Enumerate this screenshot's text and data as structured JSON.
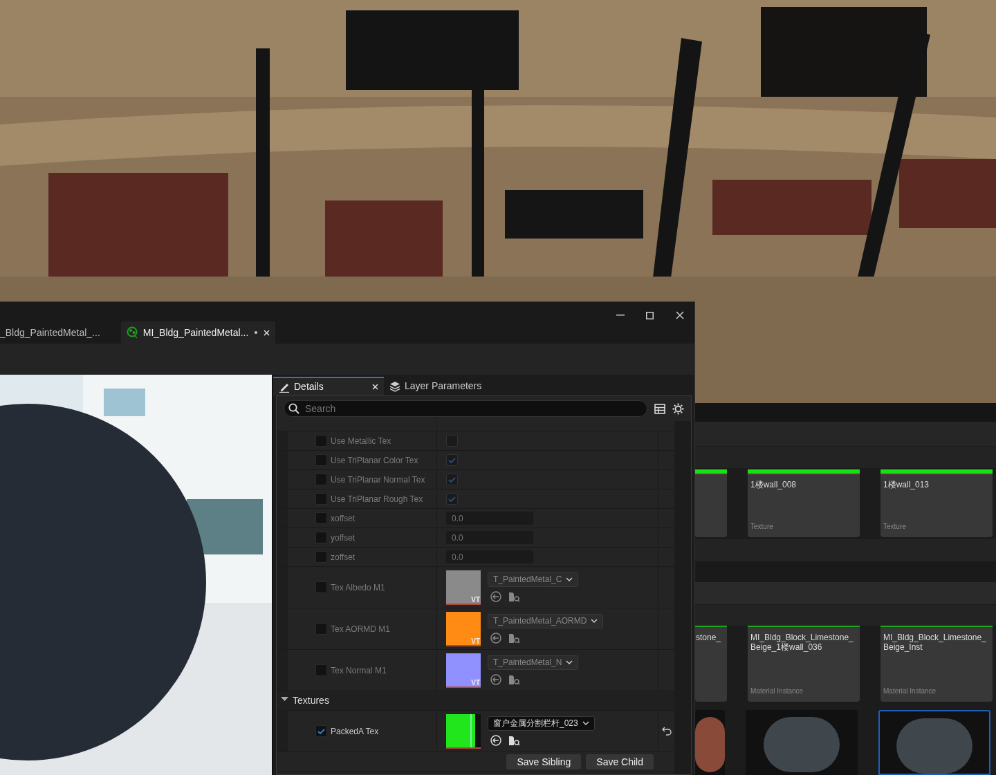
{
  "window": {
    "tabs": [
      {
        "label": "_Bldg_PaintedMetal_...",
        "selected": false,
        "dirty": false
      },
      {
        "label": "MI_Bldg_PaintedMetal...",
        "selected": true,
        "dirty": true
      }
    ]
  },
  "details": {
    "tabs": [
      {
        "label": "Details",
        "selected": true
      },
      {
        "label": "Layer Parameters",
        "selected": false
      }
    ],
    "search": {
      "placeholder": "Search"
    },
    "rows": [
      {
        "kind": "bool",
        "label": "Use Metallic Tex",
        "overridden": false,
        "checked": false
      },
      {
        "kind": "bool",
        "label": "Use TriPlanar Color Tex",
        "overridden": false,
        "checked": true
      },
      {
        "kind": "bool",
        "label": "Use TriPlanar Normal Tex",
        "overridden": false,
        "checked": true
      },
      {
        "kind": "bool",
        "label": "Use TriPlanar Rough Tex",
        "overridden": false,
        "checked": true
      },
      {
        "kind": "scalar",
        "label": "xoffset",
        "overridden": false,
        "value": "0.0"
      },
      {
        "kind": "scalar",
        "label": "yoffset",
        "overridden": false,
        "value": "0.0"
      },
      {
        "kind": "scalar",
        "label": "zoffset",
        "overridden": false,
        "value": "0.0"
      },
      {
        "kind": "texture",
        "label": "Tex Albedo M1",
        "overridden": false,
        "color": "#8a8a8a",
        "badge": "VT",
        "asset": "T_PaintedMetal_C"
      },
      {
        "kind": "texture",
        "label": "Tex AORMD M1",
        "overridden": false,
        "color": "#ff8a14",
        "badge": "VT",
        "asset": "T_PaintedMetal_AORMD"
      },
      {
        "kind": "texture",
        "label": "Tex Normal M1",
        "overridden": false,
        "color": "#9090ff",
        "badge": "VT",
        "asset": "T_PaintedMetal_N"
      },
      {
        "kind": "group",
        "label": "Textures",
        "expanded": true
      },
      {
        "kind": "texture",
        "label": "PackedA Tex",
        "overridden": true,
        "color": "#22e61c",
        "asset": "窗户金属分割栏杆_023"
      }
    ],
    "buttons": [
      "Save Sibling",
      "Save Child"
    ]
  },
  "content_browser": {
    "rows": [
      [
        {
          "color": "#e04040"
        },
        {
          "name": "1楼wall_008",
          "type": "Texture",
          "color": "#e04040"
        },
        {
          "name": "1楼wall_013",
          "type": "Texture",
          "color": "#e04040"
        }
      ],
      [
        {
          "name": "stone_",
          "color": "#1fa81f"
        },
        {
          "name": "MI_Bldg_Block_Limestone_ Beige_1楼wall_036",
          "type": "Material Instance",
          "color": "#1fa81f"
        },
        {
          "name": "MI_Bldg_Block_Limestone_ Beige_Inst",
          "type": "Material Instance",
          "color": "#1fa81f"
        }
      ]
    ],
    "thumbnails": [
      {
        "selected": false
      },
      {
        "selected": false
      },
      {
        "selected": true
      }
    ]
  }
}
